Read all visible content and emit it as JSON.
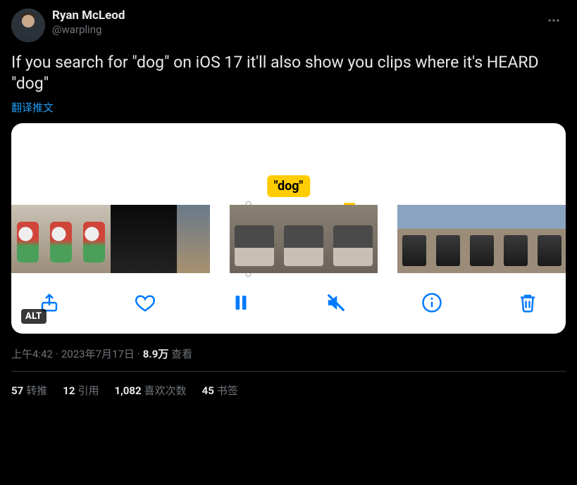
{
  "author": {
    "display_name": "Ryan McLeod",
    "handle": "@warpling"
  },
  "more_label": "更多",
  "tweet_text": "If you search for \"dog\" on iOS 17 it'll also show you clips where it's HEARD \"dog\"",
  "translate_label": "翻译推文",
  "media": {
    "caption_chip": "\"dog\"",
    "alt_badge": "ALT",
    "toolbar": {
      "share": "share",
      "like": "like",
      "pause": "pause",
      "mute": "mute",
      "info": "info",
      "trash": "trash"
    }
  },
  "meta": {
    "time": "上午4:42",
    "date": "2023年7月17日",
    "views_count": "8.9万",
    "views_label": "查看"
  },
  "stats": {
    "retweets": {
      "count": "57",
      "label": "转推"
    },
    "quotes": {
      "count": "12",
      "label": "引用"
    },
    "likes": {
      "count": "1,082",
      "label": "喜欢次数"
    },
    "bookmarks": {
      "count": "45",
      "label": "书签"
    }
  }
}
